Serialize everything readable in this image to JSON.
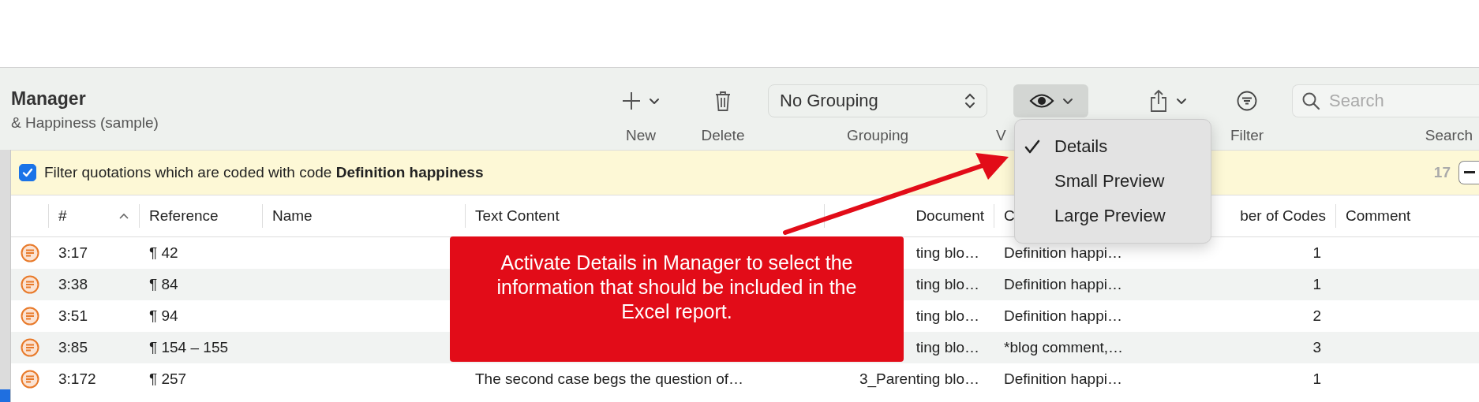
{
  "window": {
    "title": "Manager",
    "subtitle": "& Happiness (sample)"
  },
  "toolbar": {
    "items": [
      {
        "kind": "new",
        "label": "New"
      },
      {
        "kind": "delete",
        "label": "Delete"
      },
      {
        "kind": "popup",
        "value": "No Grouping",
        "label": "Grouping"
      },
      {
        "kind": "view",
        "label": "V",
        "pressed": true
      },
      {
        "kind": "share"
      },
      {
        "kind": "filter",
        "label": "Filter"
      },
      {
        "kind": "search",
        "placeholder": "Search",
        "label": "Search"
      }
    ]
  },
  "view_menu": {
    "items": [
      {
        "label": "Details",
        "selected": true
      },
      {
        "label": "Small Preview",
        "selected": false
      },
      {
        "label": "Large Preview",
        "selected": false
      }
    ]
  },
  "filter_bar": {
    "checked": true,
    "text": "Filter quotations which are coded with code **Definition happiness**",
    "count": "17"
  },
  "table": {
    "columns": [
      {
        "label": "#",
        "sorted": true
      },
      {
        "label": "Reference",
        "sorted": false
      },
      {
        "label": "Name",
        "sorted": false
      },
      {
        "label": "Text Content",
        "sorted": false
      },
      {
        "label": "Document",
        "sorted": false
      },
      {
        "label": "C",
        "sorted": false
      },
      {
        "label": "ber of Codes",
        "sorted": false
      },
      {
        "label": "Comment",
        "sorted": false
      }
    ],
    "rows": [
      {
        "number": "3:17",
        "reference": "¶ 42",
        "document": "ting blo…",
        "codes": "Definition happi…",
        "number_of_codes": "1"
      },
      {
        "number": "3:38",
        "reference": "¶ 84",
        "document": "ting blo…",
        "codes": "Definition happi…",
        "number_of_codes": "1"
      },
      {
        "number": "3:51",
        "reference": "¶ 94",
        "document": "ting blo…",
        "codes": "Definition happi…",
        "number_of_codes": "2"
      },
      {
        "number": "3:85",
        "reference": "¶ 154 – 155",
        "document": "ting blo…",
        "codes": "*blog comment,…",
        "number_of_codes": "3"
      },
      {
        "number": "3:172",
        "reference": "¶ 257",
        "text_content": "The second case begs the question of…",
        "document": "3_Parenting blo…",
        "codes": "Definition happi…",
        "number_of_codes": "1"
      }
    ]
  },
  "annotation": {
    "text": "Activate Details in Manager to select the information that should be included in the Excel report."
  }
}
